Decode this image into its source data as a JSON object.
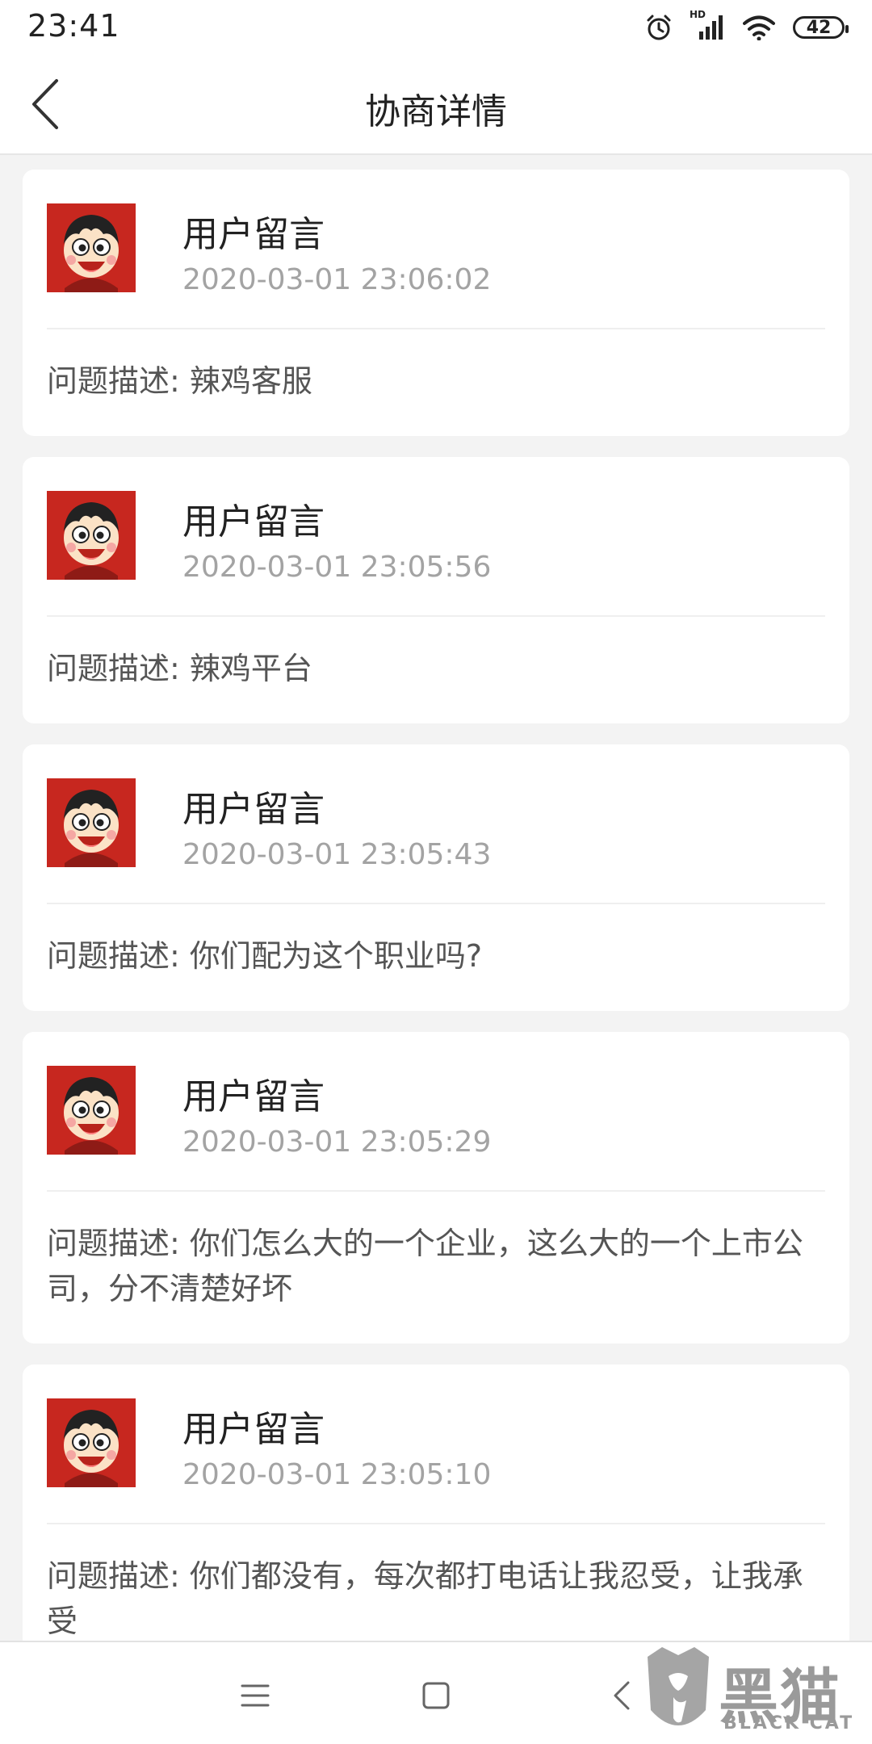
{
  "status_bar": {
    "time": "23:41",
    "battery": "42",
    "network": "HD"
  },
  "header": {
    "title": "协商详情"
  },
  "messages": [
    {
      "name": "用户留言",
      "time": "2020-03-01 23:06:02",
      "content": "问题描述: 辣鸡客服"
    },
    {
      "name": "用户留言",
      "time": "2020-03-01 23:05:56",
      "content": "问题描述: 辣鸡平台"
    },
    {
      "name": "用户留言",
      "time": "2020-03-01 23:05:43",
      "content": "问题描述: 你们配为这个职业吗?"
    },
    {
      "name": "用户留言",
      "time": "2020-03-01 23:05:29",
      "content": "问题描述: 你们怎么大的一个企业，这么大的一个上市公司，分不清楚好坏"
    },
    {
      "name": "用户留言",
      "time": "2020-03-01 23:05:10",
      "content": "问题描述: 你们都没有，每次都打电话让我忍受，让我承受"
    }
  ],
  "watermark": {
    "title": "黑猫",
    "subtitle": "BLACK CAT"
  },
  "icons": {
    "back": "chevron-left-icon",
    "alarm": "alarm-clock-icon",
    "signal": "signal-icon",
    "wifi": "wifi-icon",
    "menu": "menu-icon",
    "home": "home-icon",
    "system_back": "back-icon"
  },
  "colors": {
    "avatar_bg": "#c7271f",
    "time_text": "#a3a3a3"
  }
}
